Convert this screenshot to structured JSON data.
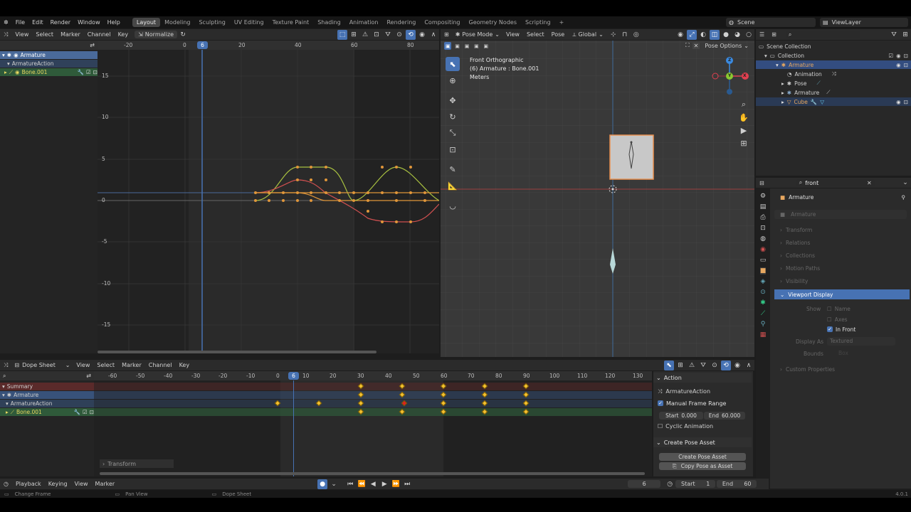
{
  "topbar": {
    "menus": [
      "File",
      "Edit",
      "Render",
      "Window",
      "Help"
    ],
    "workspaces": [
      "Layout",
      "Modeling",
      "Sculpting",
      "UV Editing",
      "Texture Paint",
      "Shading",
      "Animation",
      "Rendering",
      "Compositing",
      "Geometry Nodes",
      "Scripting"
    ],
    "active_workspace": "Layout",
    "add_tab": "+",
    "scene": "Scene",
    "view_layer": "ViewLayer"
  },
  "graph_editor": {
    "menus": [
      "View",
      "Select",
      "Marker",
      "Channel",
      "Key"
    ],
    "normalize": "Normalize",
    "current_frame": "6",
    "x_ticks": [
      "-20",
      "0",
      "20",
      "40",
      "60",
      "80"
    ],
    "y_ticks": [
      "15",
      "10",
      "5",
      "0",
      "-5",
      "-10",
      "-15"
    ],
    "channels": [
      "Armature",
      "ArmatureAction",
      "Bone.001"
    ]
  },
  "viewport": {
    "mode": "Pose Mode",
    "menus": [
      "View",
      "Select",
      "Pose"
    ],
    "orientation": "Global",
    "pose_options": "Pose Options",
    "view_name": "Front Orthographic",
    "object_info": "(6) Armature : Bone.001",
    "units": "Meters",
    "gizmo_axes": [
      "X",
      "Y",
      "Z"
    ]
  },
  "outliner": {
    "items": [
      "Scene Collection",
      "Collection",
      "Armature",
      "Animation",
      "Pose",
      "Armature",
      "Cube"
    ]
  },
  "properties": {
    "search": "front",
    "object": "Armature",
    "data_name": "Armature",
    "panels": [
      "Transform",
      "Relations",
      "Collections",
      "Motion Paths",
      "Visibility",
      "Viewport Display",
      "Custom Properties"
    ],
    "show_label": "Show",
    "name_label": "Name",
    "axes_label": "Axes",
    "in_front_label": "In Front",
    "display_as_label": "Display As",
    "display_as_value": "Textured",
    "bounds_label": "Bounds",
    "bounds_value": "Box"
  },
  "dope_sheet": {
    "mode": "Dope Sheet",
    "menus": [
      "View",
      "Select",
      "Marker",
      "Channel",
      "Key"
    ],
    "current_frame": "6",
    "ticks": [
      "-60",
      "-50",
      "-40",
      "-30",
      "-20",
      "-10",
      "0",
      "10",
      "20",
      "30",
      "40",
      "50",
      "60",
      "70",
      "80",
      "90",
      "100",
      "110",
      "120",
      "130"
    ],
    "channels": [
      "Summary",
      "Armature",
      "ArmatureAction",
      "Bone.001"
    ],
    "transform_label": "Transform"
  },
  "action_panel": {
    "title": "Action",
    "action_name": "ArmatureAction",
    "manual_frame_range": "Manual Frame Range",
    "start_label": "Start",
    "start_value": "0.000",
    "end_label": "End",
    "end_value": "60.000",
    "cyclic": "Cyclic Animation",
    "pose_asset_title": "Create Pose Asset",
    "create_btn": "Create Pose Asset",
    "copy_btn": "Copy Pose as Asset"
  },
  "timeline": {
    "menus": [
      "Playback",
      "Keying",
      "View",
      "Marker"
    ],
    "frame": "6",
    "start_label": "Start",
    "start_value": "1",
    "end_label": "End",
    "end_value": "60"
  },
  "statusbar": {
    "items": [
      "Change Frame",
      "Pan View",
      "Dope Sheet"
    ],
    "version": "4.0.1"
  },
  "colors": {
    "accent": "#4772b3",
    "keyframe": "#f2c030",
    "selected_key": "#e02020",
    "curve_orange": "#e0963a",
    "curve_green": "#a8c040",
    "curve_red": "#d05050"
  }
}
